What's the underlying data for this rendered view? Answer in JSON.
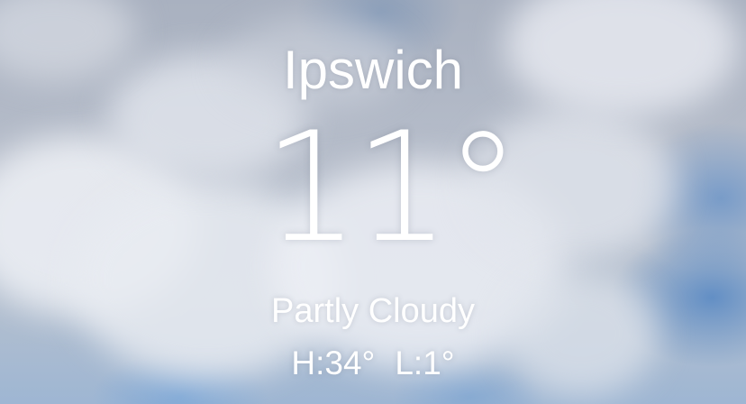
{
  "weather": {
    "city": "Ipswich",
    "temperature": "11°",
    "condition": "Partly Cloudy",
    "high": "H:34°",
    "low": "L:1°"
  },
  "background": {
    "description_icon": "cloudy-sky-background",
    "sky_blue": "#5e8cc4",
    "cloud_white": "#eef0f4",
    "cloud_grey": "#a9b1c0"
  }
}
